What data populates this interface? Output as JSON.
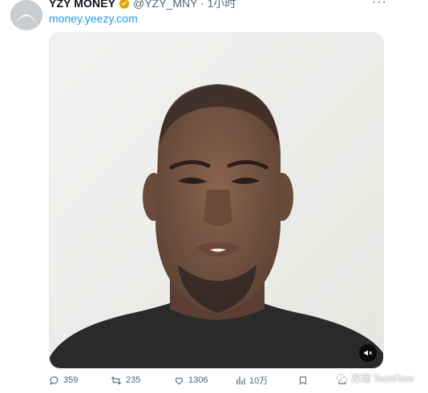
{
  "author": {
    "display_name": "YZY MONEY",
    "handle_time": "@YZY_MNY · 1小时",
    "avatar_icon": "arch-logo-icon",
    "verified_icon": "verified-badge-icon"
  },
  "post": {
    "link": "money.yeezy.com"
  },
  "media": {
    "type": "video",
    "mute_icon": "speaker-muted-icon"
  },
  "actions": {
    "reply_count": "359",
    "repost_count": "235",
    "like_count": "1306",
    "views": "10万"
  },
  "watermark": {
    "text": "深潮 TechFlow"
  },
  "colors": {
    "link": "#1d9bf0",
    "muted": "#536471",
    "verified": "#e2a500"
  }
}
